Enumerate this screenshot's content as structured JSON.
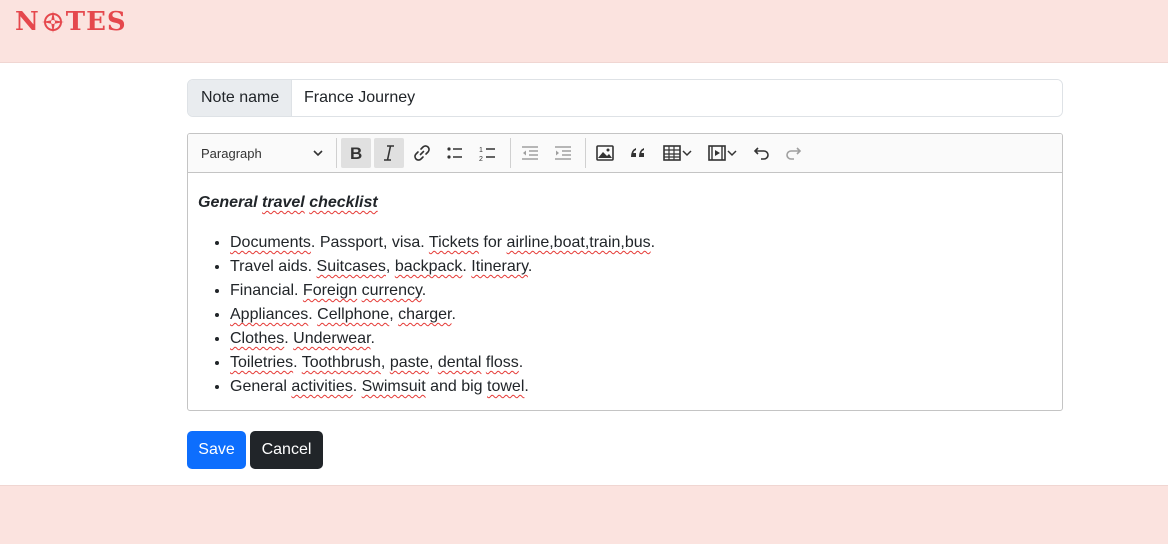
{
  "header": {
    "logo_part1": "N",
    "logo_part2": "TES"
  },
  "form": {
    "name_label": "Note name",
    "name_value": "France Journey"
  },
  "toolbar": {
    "heading_select": "Paragraph",
    "buttons": [
      "bold",
      "italic",
      "link",
      "bulleted-list",
      "numbered-list",
      "outdent",
      "indent",
      "image",
      "block-quote",
      "table",
      "media",
      "undo",
      "redo"
    ]
  },
  "content": {
    "title_words": [
      "General",
      "travel",
      "checklist"
    ],
    "items": [
      {
        "segments": [
          {
            "t": "Documents",
            "s": true
          },
          {
            "t": ". Passport, visa. "
          },
          {
            "t": "Tickets",
            "s": true
          },
          {
            "t": " for "
          },
          {
            "t": "airline,boat,train,bus",
            "s": true
          },
          {
            "t": "."
          }
        ]
      },
      {
        "segments": [
          {
            "t": "Travel aids. "
          },
          {
            "t": "Suitcases",
            "s": true
          },
          {
            "t": ", "
          },
          {
            "t": "backpack",
            "s": true
          },
          {
            "t": ". "
          },
          {
            "t": "Itinerary",
            "s": true
          },
          {
            "t": "."
          }
        ]
      },
      {
        "segments": [
          {
            "t": "Financial. "
          },
          {
            "t": "Foreign",
            "s": true
          },
          {
            "t": " "
          },
          {
            "t": "currency",
            "s": true
          },
          {
            "t": "."
          }
        ]
      },
      {
        "segments": [
          {
            "t": "Appliances",
            "s": true
          },
          {
            "t": ". "
          },
          {
            "t": "Cellphone",
            "s": true
          },
          {
            "t": ", "
          },
          {
            "t": "charger",
            "s": true
          },
          {
            "t": "."
          }
        ]
      },
      {
        "segments": [
          {
            "t": "Clothes",
            "s": true
          },
          {
            "t": ". "
          },
          {
            "t": "Underwear",
            "s": true
          },
          {
            "t": "."
          }
        ]
      },
      {
        "segments": [
          {
            "t": "Toiletries",
            "s": true
          },
          {
            "t": ". "
          },
          {
            "t": "Toothbrush",
            "s": true
          },
          {
            "t": ", "
          },
          {
            "t": "paste",
            "s": true
          },
          {
            "t": ", "
          },
          {
            "t": "dental",
            "s": true
          },
          {
            "t": " "
          },
          {
            "t": "floss",
            "s": true
          },
          {
            "t": "."
          }
        ]
      },
      {
        "segments": [
          {
            "t": "General "
          },
          {
            "t": "activities",
            "s": true
          },
          {
            "t": ". "
          },
          {
            "t": "Swimsuit",
            "s": true
          },
          {
            "t": " and big "
          },
          {
            "t": "towel",
            "s": true
          },
          {
            "t": "."
          }
        ]
      }
    ]
  },
  "actions": {
    "save_label": "Save",
    "cancel_label": "Cancel"
  },
  "colors": {
    "header_bg": "#fbe3df",
    "logo": "#e5484d",
    "primary": "#0d6efd",
    "dark": "#212529",
    "spellcheck": "#e53935"
  }
}
